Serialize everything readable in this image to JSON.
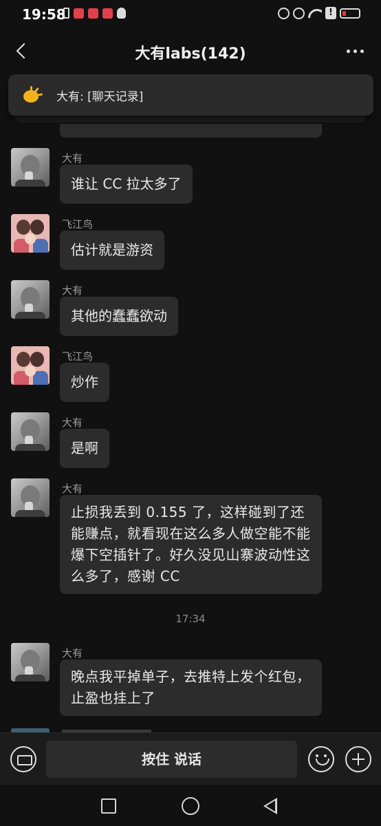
{
  "status_bar": {
    "time": "19:58",
    "alert_glyph": "!"
  },
  "header": {
    "title": "大有labs(142)"
  },
  "pinned": {
    "text": "大有: [聊天记录]"
  },
  "messages": [
    {
      "sender": "大有",
      "text": "谁让 CC 拉太多了",
      "avatar": "gray-boy-avatar"
    },
    {
      "sender": "飞江鸟",
      "text": "估计就是游资",
      "avatar": "pink-family-avatar"
    },
    {
      "sender": "大有",
      "text": "其他的蠢蠢欲动",
      "avatar": "gray-boy-avatar"
    },
    {
      "sender": "飞江鸟",
      "text": "炒作",
      "avatar": "pink-family-avatar"
    },
    {
      "sender": "大有",
      "text": "是啊",
      "avatar": "gray-boy-avatar"
    },
    {
      "sender": "大有",
      "text": "止损我丢到 0.155 了，这样碰到了还能赚点，就看现在这么多人做空能不能爆下空插针了。好久没见山寨波动性这么多了，感谢 CC",
      "avatar": "gray-boy-avatar"
    },
    {
      "sender": "大有",
      "text": "晚点我平掉单子，去推特上发个红包，止盈也挂上了",
      "avatar": "gray-boy-avatar"
    }
  ],
  "timestamp": "17:34",
  "input_bar": {
    "talk_label": "按住 说话"
  },
  "colors": {
    "background": "#111111",
    "bubble": "#2c2c2c",
    "pinned_icon": "#f1b21c"
  }
}
